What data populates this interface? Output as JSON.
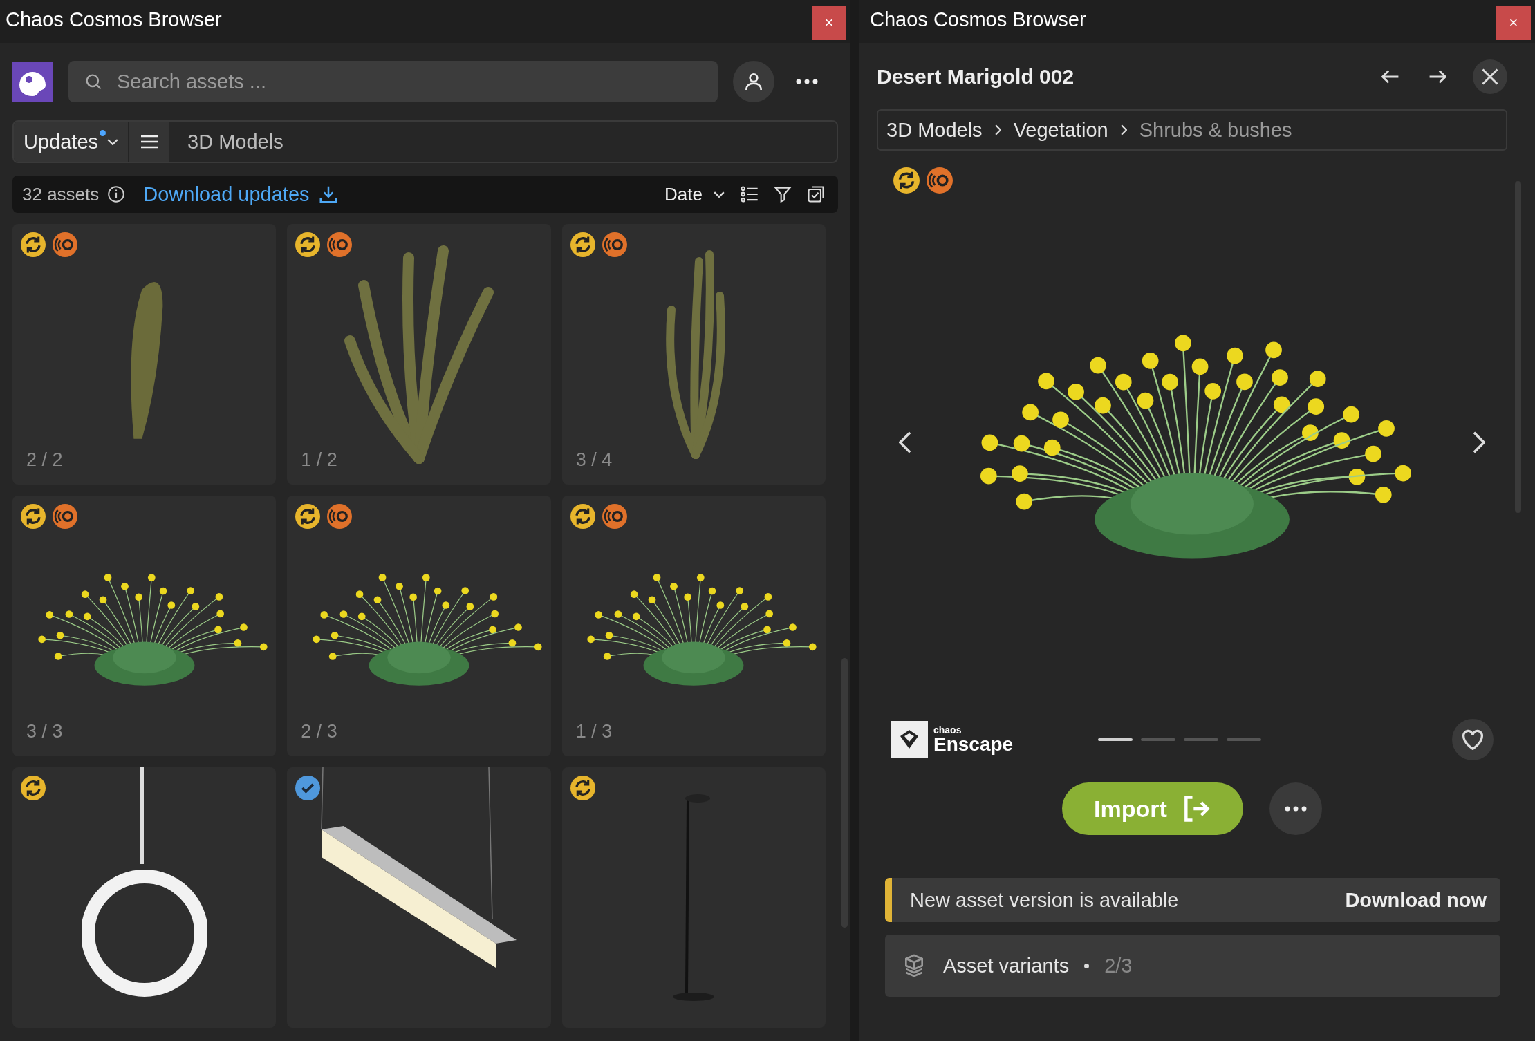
{
  "left_window": {
    "title": "Chaos Cosmos Browser",
    "close": "×",
    "search": {
      "placeholder": "Search assets ..."
    },
    "filter": {
      "dropdown": "Updates",
      "has_updates": true,
      "category": "3D Models"
    },
    "toolbar": {
      "count": "32 assets",
      "action": "Download updates",
      "sort": "Date"
    },
    "cards": [
      {
        "kind": "cactus-single",
        "badges": [
          {
            "kind": "update"
          },
          {
            "kind": "enscape"
          }
        ],
        "counter": "2 / 2"
      },
      {
        "kind": "cactus-cluster",
        "badges": [
          {
            "kind": "update"
          },
          {
            "kind": "enscape"
          }
        ],
        "counter": "1 / 2"
      },
      {
        "kind": "cactus-thin",
        "badges": [
          {
            "kind": "update"
          },
          {
            "kind": "enscape"
          }
        ],
        "counter": "3 / 4"
      },
      {
        "kind": "flower-shrub",
        "badges": [
          {
            "kind": "update"
          },
          {
            "kind": "enscape"
          }
        ],
        "counter": "3 / 3"
      },
      {
        "kind": "flower-shrub",
        "badges": [
          {
            "kind": "update"
          },
          {
            "kind": "enscape"
          }
        ],
        "counter": "2 / 3"
      },
      {
        "kind": "flower-shrub",
        "badges": [
          {
            "kind": "update"
          },
          {
            "kind": "enscape"
          }
        ],
        "counter": "1 / 3"
      },
      {
        "kind": "ring-lamp",
        "badges": [
          {
            "kind": "update"
          }
        ]
      },
      {
        "kind": "linear-lamp",
        "badges": [
          {
            "kind": "downloaded"
          }
        ]
      },
      {
        "kind": "floor-lamp",
        "badges": [
          {
            "kind": "update"
          }
        ]
      }
    ]
  },
  "right_window": {
    "title": "Chaos Cosmos Browser",
    "close": "×",
    "asset_name": "Desert Marigold 002",
    "breadcrumb": [
      {
        "label": "3D Models",
        "current": false
      },
      {
        "label": "Vegetation",
        "current": false
      },
      {
        "label": "Shrubs & bushes",
        "current": true
      }
    ],
    "badges": [
      {
        "kind": "update"
      },
      {
        "kind": "enscape"
      }
    ],
    "brand": {
      "small": "chaos",
      "name": "Enscape"
    },
    "carousel": [
      {
        "selected": true
      },
      {
        "selected": false
      },
      {
        "selected": false
      },
      {
        "selected": false
      }
    ],
    "import": "Import",
    "notice": {
      "text": "New asset version is available",
      "action": "Download now"
    },
    "variants": {
      "label": "Asset variants",
      "count": "2/3"
    }
  }
}
